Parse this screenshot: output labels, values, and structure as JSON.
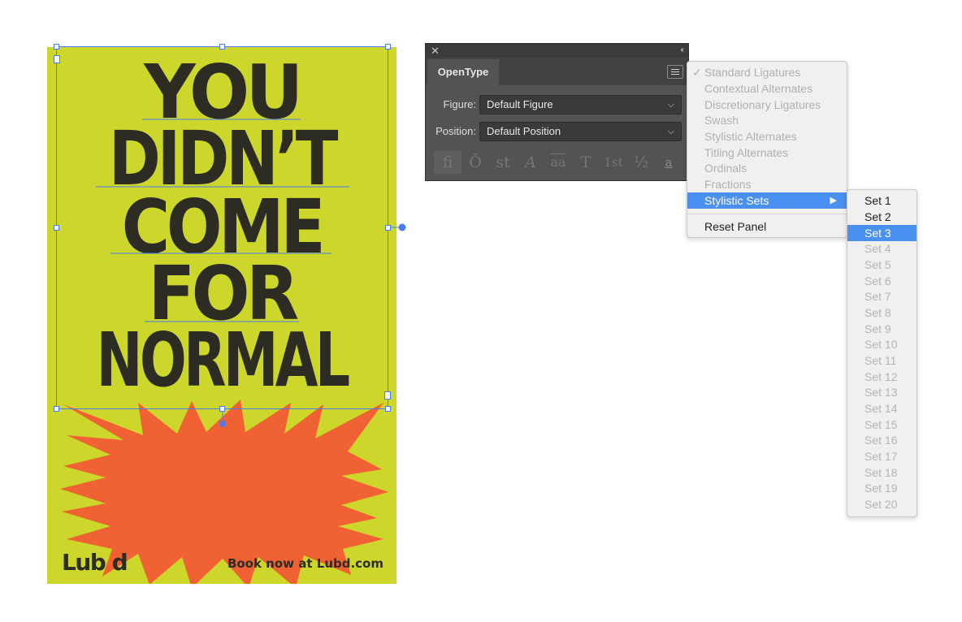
{
  "poster": {
    "headline": [
      "YOU",
      "DIDN’T",
      "COME",
      "FOR",
      "NORMAL"
    ],
    "logo": "Lub d",
    "cta": "Book now at Lubd.com",
    "colors": {
      "background": "#cdd62a",
      "text": "#2d2c22",
      "burst": "#f06233",
      "selection": "#4a7cf0"
    }
  },
  "panel": {
    "close_icon": "close-icon",
    "collapse_icon": "double-chevron-left-icon",
    "tab": "OpenType",
    "figure_label": "Figure:",
    "figure_value": "Default Figure",
    "position_label": "Position:",
    "position_value": "Default Position",
    "icon_glyphs": [
      "fi",
      "Ǒ",
      "st",
      "A",
      "aa",
      "T",
      "1st",
      "½",
      "a"
    ],
    "icon_names": [
      "standard-ligatures-icon",
      "contextual-alternates-icon",
      "discretionary-ligatures-icon",
      "swash-icon",
      "stylistic-alternates-icon",
      "titling-alternates-icon",
      "ordinals-icon",
      "fractions-icon",
      "glyph-panel-icon"
    ]
  },
  "menu": {
    "items": [
      {
        "label": "Standard Ligatures",
        "checked": true
      },
      {
        "label": "Contextual Alternates"
      },
      {
        "label": "Discretionary Ligatures"
      },
      {
        "label": "Swash"
      },
      {
        "label": "Stylistic Alternates"
      },
      {
        "label": "Titling Alternates"
      },
      {
        "label": "Ordinals"
      },
      {
        "label": "Fractions"
      },
      {
        "label": "Stylistic Sets",
        "active": true,
        "submenu": true
      }
    ],
    "reset": "Reset Panel",
    "check_glyph": "✓",
    "arrow_glyph": "▶"
  },
  "submenu": {
    "items": [
      "Set 1",
      "Set 2",
      "Set 3",
      "Set 4",
      "Set 5",
      "Set 6",
      "Set 7",
      "Set 8",
      "Set 9",
      "Set 10",
      "Set 11",
      "Set 12",
      "Set 13",
      "Set 14",
      "Set 15",
      "Set 16",
      "Set 17",
      "Set 18",
      "Set 19",
      "Set 20"
    ],
    "enabled": [
      "Set 1",
      "Set 2",
      "Set 3"
    ],
    "active": "Set 3"
  }
}
